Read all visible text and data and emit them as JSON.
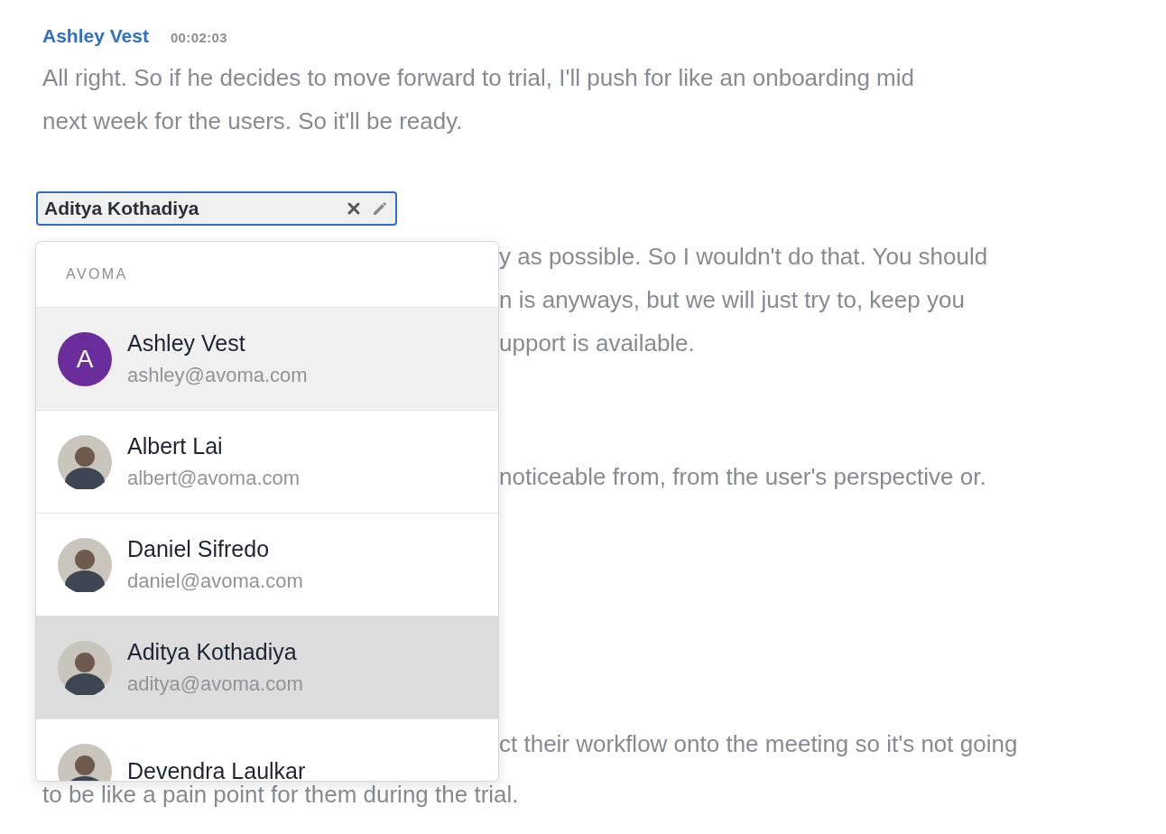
{
  "message": {
    "speaker": "Ashley Vest",
    "time": "00:02:03",
    "lines": [
      "All right. So if he decides to move forward to trial, I'll push for like an onboarding mid",
      "next week for the users. So it'll be ready."
    ]
  },
  "speaker_field": {
    "value": "Aditya Kothadiya"
  },
  "background_paragraphs": [
    {
      "lines": [
        "y as possible. So I wouldn't do that. You should",
        "n is anyways, but we will just try to, keep you",
        "upport is available."
      ]
    },
    {
      "lines": [
        "noticeable from, from the user's perspective or."
      ]
    },
    {
      "lines": [
        "ct their workflow onto the meeting so it's not going"
      ]
    }
  ],
  "last_line": "to be like a pain point for them during the trial.",
  "dropdown": {
    "group": "AVOMA",
    "people": [
      {
        "name": "Ashley Vest",
        "email": "ashley@avoma.com",
        "kind": "initial",
        "initial": "A",
        "color": "#6b2d9b",
        "highlighted": true,
        "selected": false
      },
      {
        "name": "Albert Lai",
        "email": "albert@avoma.com",
        "kind": "photo",
        "highlighted": false,
        "selected": false
      },
      {
        "name": "Daniel Sifredo",
        "email": "daniel@avoma.com",
        "kind": "photo",
        "highlighted": false,
        "selected": false
      },
      {
        "name": "Aditya Kothadiya",
        "email": "aditya@avoma.com",
        "kind": "photo",
        "highlighted": false,
        "selected": true
      },
      {
        "name": "Devendra Laulkar",
        "kind": "photo",
        "highlighted": false,
        "selected": false
      }
    ]
  }
}
